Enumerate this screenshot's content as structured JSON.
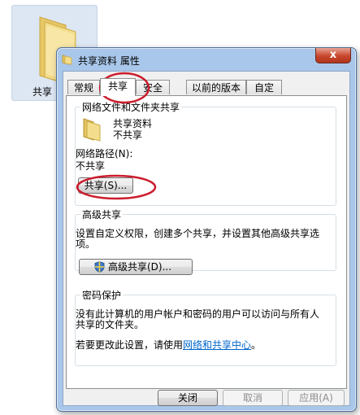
{
  "desktop": {
    "folder_label": "共享"
  },
  "window": {
    "title": "共享资料 属性",
    "close_label": "x",
    "tabs": [
      "常规",
      "共享",
      "安全",
      "以前的版本",
      "自定义"
    ]
  },
  "network_sharing": {
    "group_title": "网络文件和文件夹共享",
    "folder_name": "共享资料",
    "folder_status": "不共享",
    "path_label": "网络路径(N):",
    "path_value": "不共享",
    "share_button": "共享(S)..."
  },
  "advanced_sharing": {
    "group_title": "高级共享",
    "description_line1": "设置自定义权限，创建多个共享，并设置其他高级共享选",
    "description_line2": "项。",
    "button": "高级共享(D)..."
  },
  "password_protection": {
    "group_title": "密码保护",
    "description_line1": "没有此计算机的用户帐户和密码的用户可以访问与所有人",
    "description_line2": "共享的文件夹。",
    "change_prefix": "若要更改此设置，请使用",
    "change_link": "网络和共享中心",
    "change_suffix": "。"
  },
  "footer": {
    "close": "关闭",
    "cancel": "取消",
    "apply": "应用(A)"
  },
  "colors": {
    "annotation": "#cc1d2e",
    "link": "#0066cc"
  }
}
